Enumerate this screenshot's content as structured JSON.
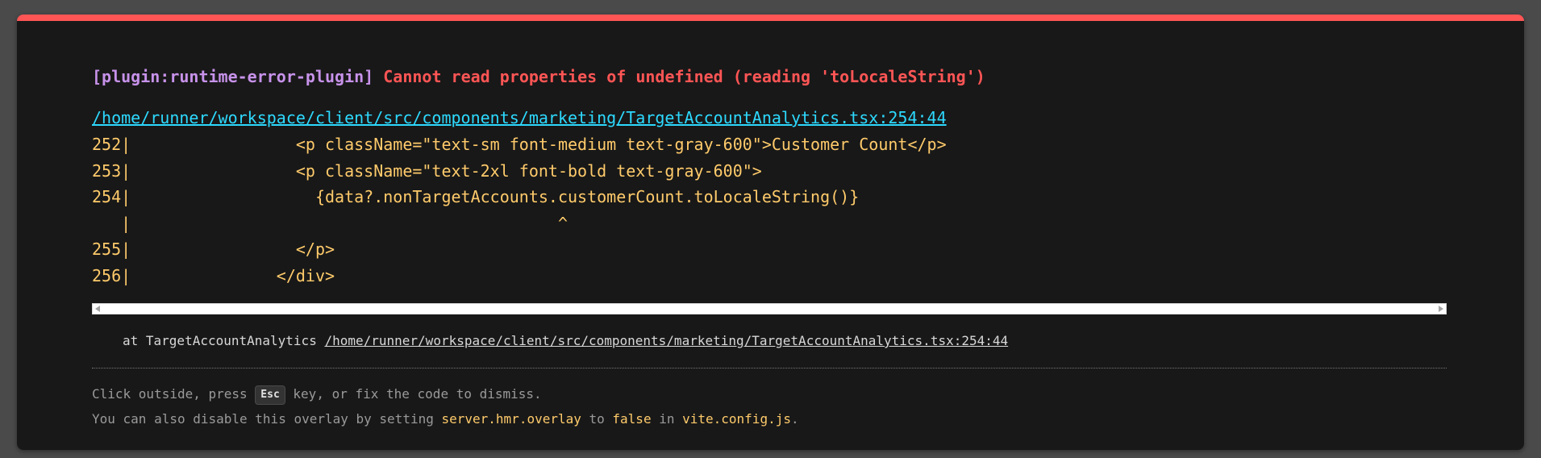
{
  "overlay": {
    "plugin": "[plugin:runtime-error-plugin]",
    "message": "Cannot read properties of undefined (reading 'toLocaleString')",
    "file": "/home/runner/workspace/client/src/components/marketing/TargetAccountAnalytics.tsx:254:44",
    "frame_lines": [
      "252|                 <p className=\"text-sm font-medium text-gray-600\">Customer Count</p>",
      "253|                 <p className=\"text-2xl font-bold text-gray-600\">",
      "254|                   {data?.nonTargetAccounts.customerCount.toLocaleString()}",
      "   |                                            ^",
      "255|                 </p>",
      "256|               </div>"
    ],
    "stack_prefix": "at TargetAccountAnalytics ",
    "stack_file": "/home/runner/workspace/client/src/components/marketing/TargetAccountAnalytics.tsx:254:44",
    "tip1_before": "Click outside, press ",
    "tip1_key": "Esc",
    "tip1_after": " key, or fix the code to dismiss.",
    "tip2_part1": "You can also disable this overlay by setting ",
    "tip2_code1": "server.hmr.overlay",
    "tip2_part2": " to ",
    "tip2_code2": "false",
    "tip2_part3": " in ",
    "tip2_code3": "vite.config.js",
    "tip2_part4": ".",
    "colors": {
      "accent_border": "#ff5555",
      "plugin": "#c792ea",
      "error": "#ff5555",
      "file_link": "#2dd9fe",
      "code": "#ffcb6b"
    }
  }
}
